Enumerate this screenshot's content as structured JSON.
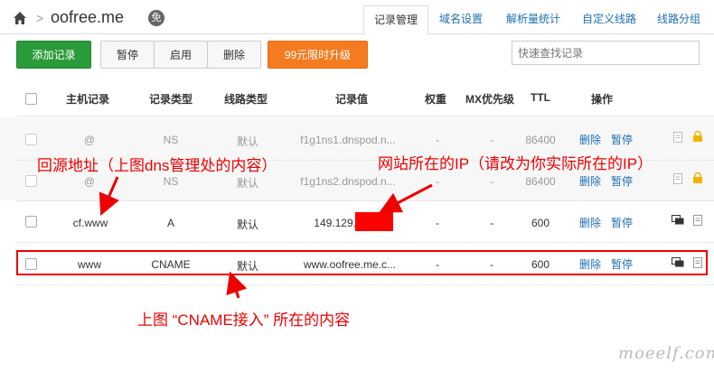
{
  "header": {
    "domain": "oofree.me",
    "badge": "免",
    "tabs": [
      {
        "label": "记录管理",
        "active": true
      },
      {
        "label": "域名设置"
      },
      {
        "label": "解析量统计"
      },
      {
        "label": "自定义线路"
      },
      {
        "label": "线路分组"
      }
    ]
  },
  "toolbar": {
    "add": "添加记录",
    "pause": "暂停",
    "enable": "启用",
    "delete": "删除",
    "upgrade": "99元限时升级",
    "search_placeholder": "快速查找记录"
  },
  "table": {
    "headers": [
      "主机记录",
      "记录类型",
      "线路类型",
      "记录值",
      "权重",
      "MX优先级",
      "TTL",
      "操作"
    ],
    "rows": [
      {
        "host": "@",
        "type": "NS",
        "line": "默认",
        "value": "f1g1ns1.dnspod.n...",
        "weight": "-",
        "mx": "-",
        "ttl": "86400",
        "del": "删除",
        "pause": "暂停",
        "disabled": true
      },
      {
        "host": "@",
        "type": "NS",
        "line": "默认",
        "value": "f1g1ns2.dnspod.n...",
        "weight": "-",
        "mx": "-",
        "ttl": "86400",
        "del": "删除",
        "pause": "暂停",
        "disabled": true
      },
      {
        "host": "cf.www",
        "type": "A",
        "line": "默认",
        "value": "149.129.",
        "weight": "-",
        "mx": "-",
        "ttl": "600",
        "del": "删除",
        "pause": "暂停",
        "disabled": false
      },
      {
        "host": "www",
        "type": "CNAME",
        "line": "默认",
        "value": "www.oofree.me.c...",
        "weight": "-",
        "mx": "-",
        "ttl": "600",
        "del": "删除",
        "pause": "暂停",
        "disabled": false
      }
    ]
  },
  "annotations": {
    "left": "回源地址（上图dns管理处的内容）",
    "right": "网站所在的IP（请改为你实际所在的IP）",
    "bottom": "上图 “CNAME接入” 所在的内容",
    "color": "#e00000"
  },
  "watermark": "moeelf.com",
  "colors": {
    "primary_green": "#2a9a3a",
    "upgrade_orange": "#f57b20",
    "link_blue": "#1c6fb3"
  }
}
